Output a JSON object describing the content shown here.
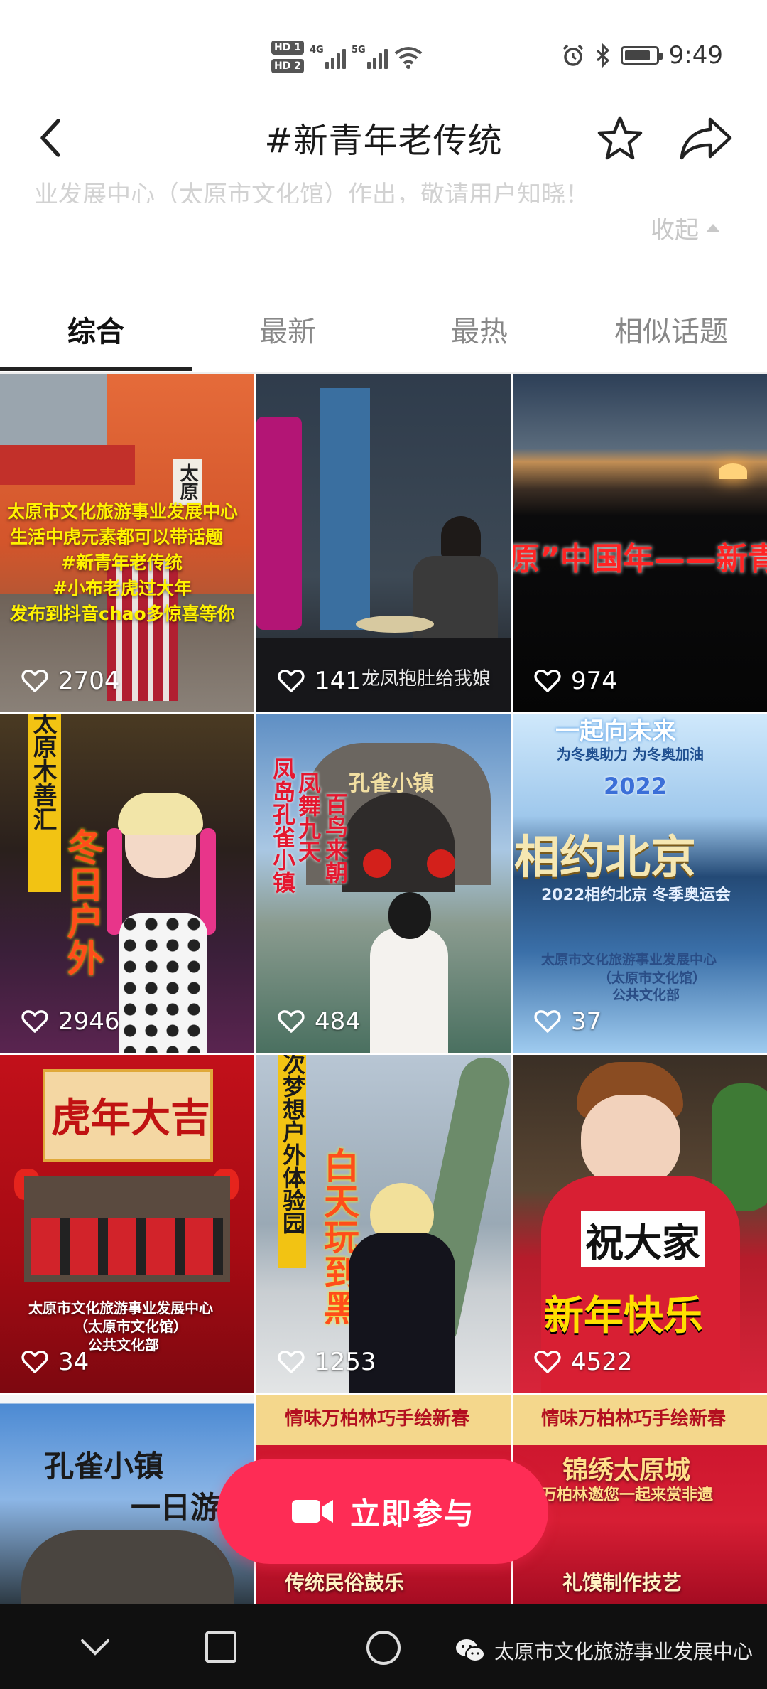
{
  "status_bar": {
    "sim1": "HD 1",
    "sim2": "HD 2",
    "net1": "4G",
    "net2": "5G",
    "time": "9:49",
    "battery_level": 0.85
  },
  "header": {
    "title": "#新青年老传统"
  },
  "description": {
    "text": "业发展中心（太原市文化馆）作出，敬请用户知晓！",
    "collapse_label": "收起"
  },
  "tabs": [
    {
      "label": "综合",
      "active": true
    },
    {
      "label": "最新",
      "active": false
    },
    {
      "label": "最热",
      "active": false
    },
    {
      "label": "相似话题",
      "active": false
    }
  ],
  "videos": [
    {
      "likes": "2704",
      "caption_lines": [
        "太原市文化旅游事业发展中心",
        "生活中虎元素都可以带话题",
        "#新青年老传统",
        "#小布老虎过大年",
        "发布到抖音chao多惊喜等你"
      ],
      "sign_text": "太原"
    },
    {
      "likes": "141",
      "overlay": "龙凤抱肚给我娘"
    },
    {
      "likes": "974",
      "overlay": "原”中国年——新青"
    },
    {
      "likes": "2946",
      "vertical_1": "太原木善汇",
      "vertical_2": "冬日户外"
    },
    {
      "likes": "484",
      "vertical_1": "凤舞九天",
      "vertical_2": "凤岛孔雀小镇",
      "vertical_3": "百鸟来朝",
      "sign": "孔雀小镇"
    },
    {
      "likes": "37",
      "top": "一起向未来",
      "sub": "为冬奥助力 为冬奥加油",
      "year": "2022",
      "big": "相约北京",
      "banner": "2022相约北京 冬季奥运会",
      "org1": "太原市文化旅游事业发展中心",
      "org2": "（太原市文化馆）",
      "org3": "公共文化部"
    },
    {
      "likes": "34",
      "title": "虎年大吉",
      "org1": "太原市文化旅游事业发展中心",
      "org2": "（太原市文化馆）",
      "org3": "公共文化部"
    },
    {
      "likes": "1253",
      "vertical_1": "次梦想户外体验园",
      "vertical_2": "白天玩到黑"
    },
    {
      "likes": "4522",
      "line1": "祝大家",
      "line2": "新年快乐"
    },
    {
      "title": "孔雀小镇",
      "sub": "一日游"
    },
    {
      "top": "情味万柏林巧手绘新春",
      "bottom": "传统民俗鼓乐"
    },
    {
      "top": "情味万柏林巧手绘新春",
      "mid": "锦绣太原城",
      "sub": "万柏林邀您一起来赏非遗",
      "bottom": "礼馍制作技艺"
    }
  ],
  "join_button": {
    "label": "立即参与"
  },
  "watermark": {
    "text": "太原市文化旅游事业发展中心"
  },
  "colors": {
    "accent": "#fe2c55"
  }
}
